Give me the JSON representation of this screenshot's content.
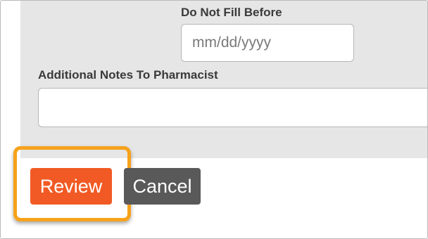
{
  "form": {
    "do_not_fill_before": {
      "label": "Do Not Fill Before",
      "placeholder": "mm/dd/yyyy",
      "value": "",
      "icon": "calendar-icon"
    },
    "additional_notes": {
      "label": "Additional Notes To Pharmacist",
      "value": ""
    }
  },
  "actions": {
    "review_label": "Review",
    "cancel_label": "Cancel"
  },
  "colors": {
    "form_background": "#e6e6e6",
    "review_button": "#f15a24",
    "cancel_button": "#595959",
    "highlight_outline": "#f6a21b",
    "label_text": "#3a3a3a"
  }
}
